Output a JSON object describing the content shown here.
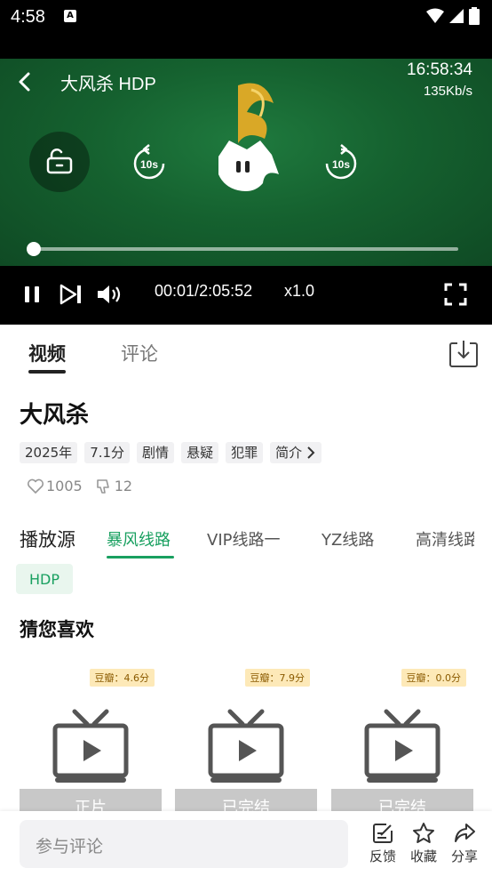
{
  "status": {
    "time": "4:58",
    "badge": "A"
  },
  "player": {
    "title": "大风杀 HDP",
    "clock": "16:58:34",
    "speed": "135Kb/s",
    "rewind_label": "10s",
    "forward_label": "10s",
    "progress": 0.0001,
    "current_time": "00:01",
    "separator": "/",
    "duration": "2:05:52",
    "rate": "x1.0"
  },
  "tabs": {
    "video": "视频",
    "comment": "评论"
  },
  "movie": {
    "title": "大风杀",
    "tags": [
      "2025年",
      "7.1分",
      "剧情",
      "悬疑",
      "犯罪"
    ],
    "intro": "简介",
    "likes": "1005",
    "dislikes": "12"
  },
  "sources": {
    "label": "播放源",
    "lines": [
      "暴风线路",
      "VIP线路一",
      "YZ线路",
      "高清线路"
    ],
    "active_index": 0,
    "episode": "HDP"
  },
  "recommend": {
    "title": "猜您喜欢",
    "cards": [
      {
        "rating": "豆瓣：4.6分",
        "status": "正片"
      },
      {
        "rating": "豆瓣：7.9分",
        "status": "已完结"
      },
      {
        "rating": "豆瓣：0.0分",
        "status": "已完结"
      }
    ]
  },
  "bottom": {
    "comment_placeholder": "参与评论",
    "feedback": "反馈",
    "favorite": "收藏",
    "share": "分享"
  },
  "colors": {
    "accent": "#19a060",
    "player_bg": "#15612f"
  }
}
